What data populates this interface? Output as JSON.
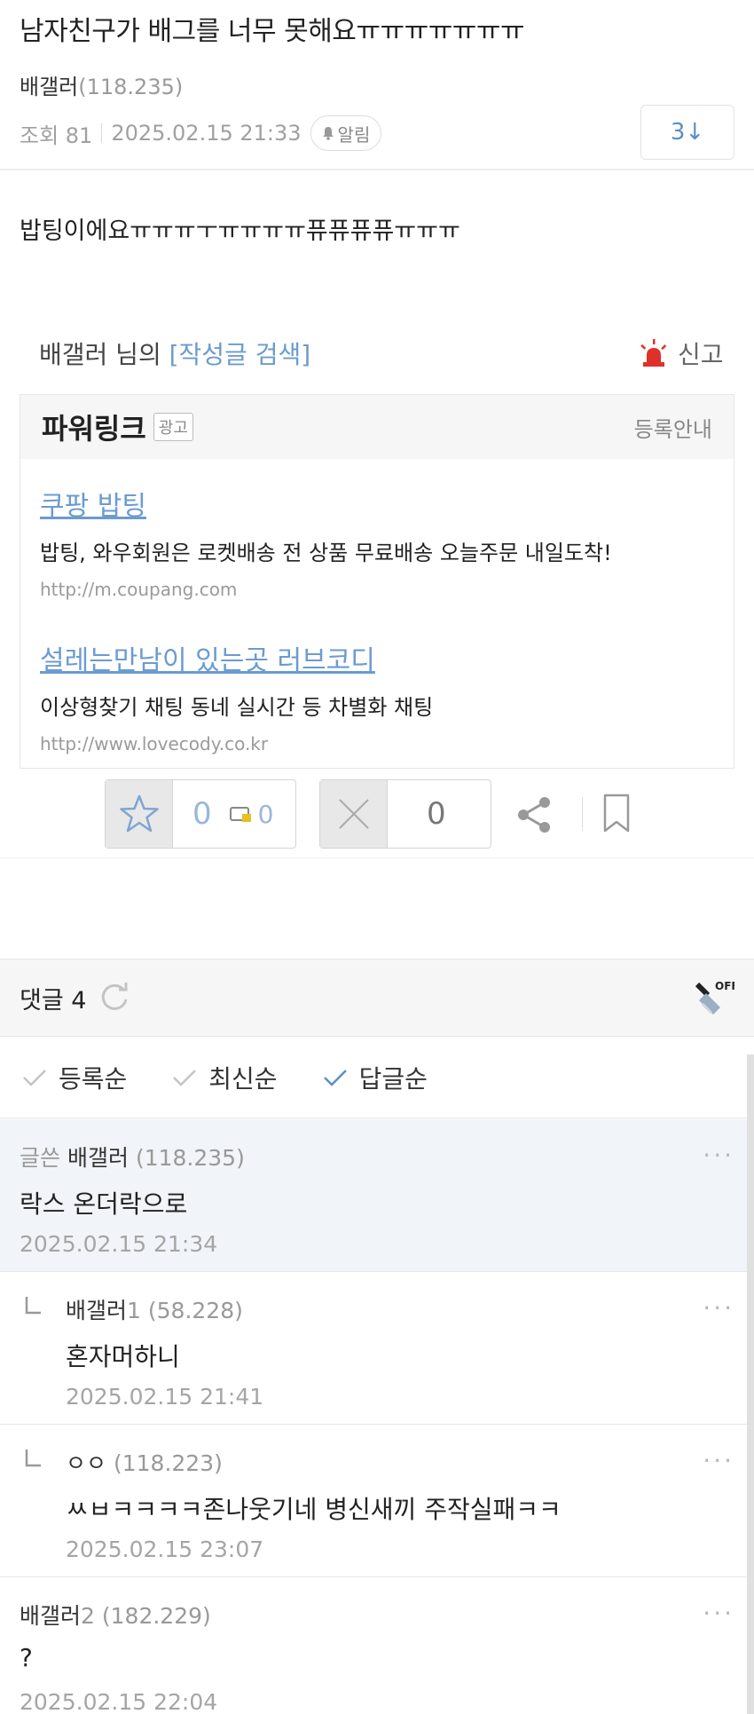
{
  "post": {
    "title": "남자친구가 배그를 너무 못해요ㅠㅠㅠㅠㅠㅠㅠ",
    "author": "배갤러",
    "author_ip": "(118.235)",
    "views": "조회 81",
    "datetime": "2025.02.15 21:33",
    "alarm_label": "알림",
    "reply_jump": "3↓",
    "body": "밥팅이에요ㅠㅠㅠㅜㅠㅠㅠㅠ퓨퓨퓨퓨ㅠㅠㅠ"
  },
  "author_search": {
    "prefix": "배갤러 님의 ",
    "link": "[작성글 검색]",
    "report": "신고"
  },
  "powerlink": {
    "title": "파워링크",
    "badge": "광고",
    "register": "등록안내",
    "ads": [
      {
        "title": "쿠팡 밥팅",
        "desc": "밥팅, 와우회원은 로켓배송 전 상품 무료배송 오늘주문 내일도착!",
        "url": "http://m.coupang.com"
      },
      {
        "title": "설레는만남이 있는곳 러브코디",
        "desc": "이상형찾기 채팅 동네 실시간 등 차별화 채팅",
        "url": "http://www.lovecody.co.kr"
      }
    ]
  },
  "actions": {
    "recommend": "0",
    "fixed_recommend": "0",
    "dislike": "0"
  },
  "comments_header": {
    "label": "댓글 4",
    "clean_icon_text": "OFF"
  },
  "sort": [
    "등록순",
    "최신순",
    "답글순"
  ],
  "comments": [
    {
      "tag": "글쓴",
      "name": "배갤러",
      "ip": "(118.235)",
      "text": "락스 온더락으로",
      "date": "2025.02.15 21:34"
    },
    {
      "name": "배갤러",
      "suffix": "1",
      "ip": "(58.228)",
      "text": "혼자머하니",
      "date": "2025.02.15 21:41"
    },
    {
      "name": "ㅇㅇ",
      "ip": "(118.223)",
      "text": "ㅆㅂㅋㅋㅋㅋ존나웃기네 병신새끼 주작실패ㅋㅋ",
      "date": "2025.02.15 23:07"
    },
    {
      "name": "배갤러",
      "suffix": "2",
      "ip": "(182.229)",
      "text": "?",
      "date": "2025.02.15 22:04"
    }
  ],
  "colors": {
    "link_blue": "#6b9bd1",
    "report_red": "#e0302b",
    "op_comment_bg": "#f1f4f8",
    "muted_text": "#999999"
  },
  "icons": [
    "bell-icon",
    "siren-icon",
    "star-icon",
    "fixed-recommend-icon",
    "x-icon",
    "share-icon",
    "bookmark-icon",
    "refresh-icon",
    "clean-comment-icon",
    "check-icon",
    "reply-arrow-icon",
    "more-icon"
  ]
}
